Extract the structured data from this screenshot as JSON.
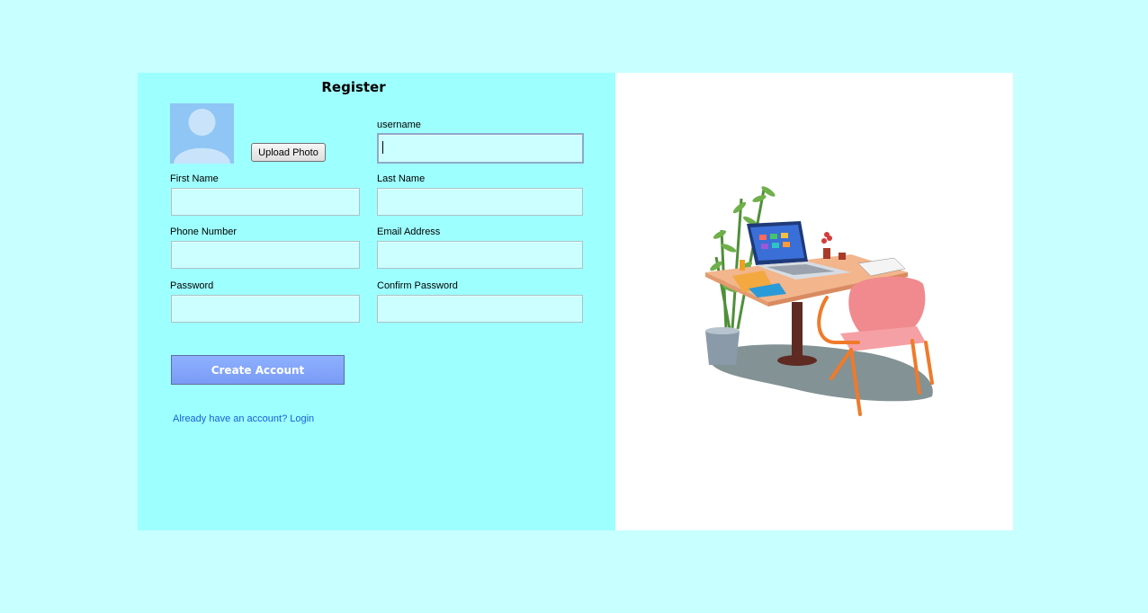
{
  "form": {
    "title": "Register",
    "upload_photo_label": "Upload Photo",
    "fields": {
      "username": {
        "label": "username",
        "value": ""
      },
      "first_name": {
        "label": "First Name",
        "value": ""
      },
      "last_name": {
        "label": "Last Name",
        "value": ""
      },
      "phone_number": {
        "label": "Phone Number",
        "value": ""
      },
      "email_address": {
        "label": "Email Address",
        "value": ""
      },
      "password": {
        "label": "Password",
        "value": ""
      },
      "confirm_password": {
        "label": "Confirm Password",
        "value": ""
      }
    },
    "create_account_label": "Create Account",
    "login_link": "Already have an account? Login"
  },
  "icons": {
    "avatar": "user-avatar-placeholder-icon",
    "illustration": "desk-laptop-chair-illustration"
  },
  "colors": {
    "page_background": "#c8ffff",
    "form_background": "#9effff",
    "input_background": "#ccffff",
    "create_button": "#84a5fa",
    "link": "#1560d8"
  }
}
